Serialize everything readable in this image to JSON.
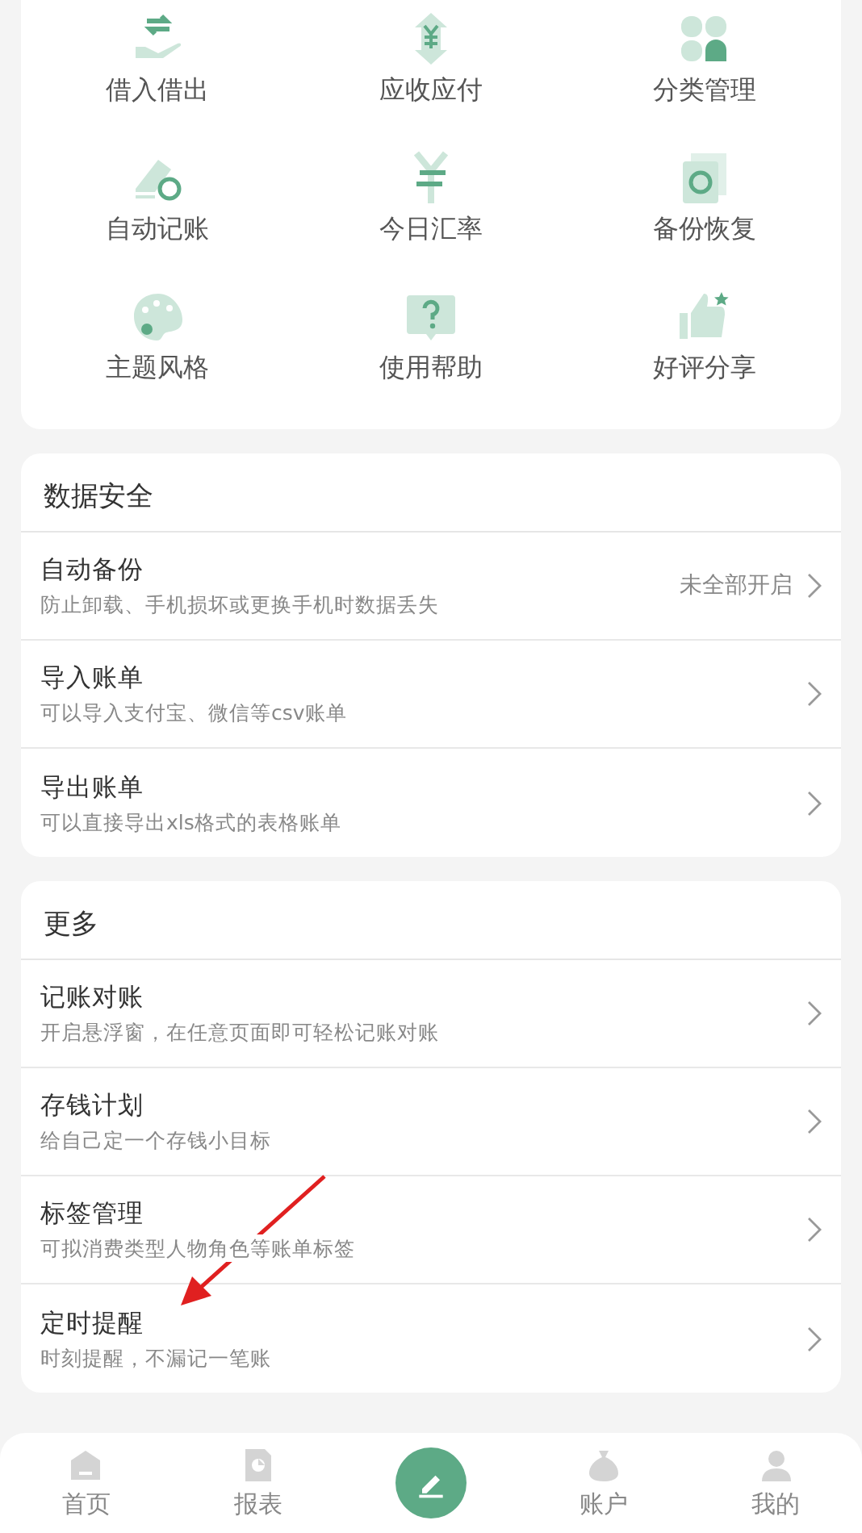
{
  "tools": [
    {
      "label": "借入借出"
    },
    {
      "label": "应收应付"
    },
    {
      "label": "分类管理"
    },
    {
      "label": "自动记账"
    },
    {
      "label": "今日汇率"
    },
    {
      "label": "备份恢复"
    },
    {
      "label": "主题风格"
    },
    {
      "label": "使用帮助"
    },
    {
      "label": "好评分享"
    }
  ],
  "sections": [
    {
      "title": "数据安全",
      "items": [
        {
          "title": "自动备份",
          "subtitle": "防止卸载、手机损坏或更换手机时数据丢失",
          "value": "未全部开启"
        },
        {
          "title": "导入账单",
          "subtitle": "可以导入支付宝、微信等csv账单"
        },
        {
          "title": "导出账单",
          "subtitle": "可以直接导出xls格式的表格账单"
        }
      ]
    },
    {
      "title": "更多",
      "items": [
        {
          "title": "记账对账",
          "subtitle": "开启悬浮窗，在任意页面即可轻松记账对账"
        },
        {
          "title": "存钱计划",
          "subtitle": "给自己定一个存钱小目标"
        },
        {
          "title": "标签管理",
          "subtitle": "可拟消费类型人物角色等账单标签"
        },
        {
          "title": "定时提醒",
          "subtitle": "时刻提醒，不漏记一笔账"
        }
      ]
    }
  ],
  "bottom_nav": [
    {
      "label": "首页",
      "kind": "tab"
    },
    {
      "label": "报表",
      "kind": "tab"
    },
    {
      "kind": "add"
    },
    {
      "label": "账户",
      "kind": "tab"
    },
    {
      "label": "我的",
      "kind": "tab"
    }
  ]
}
